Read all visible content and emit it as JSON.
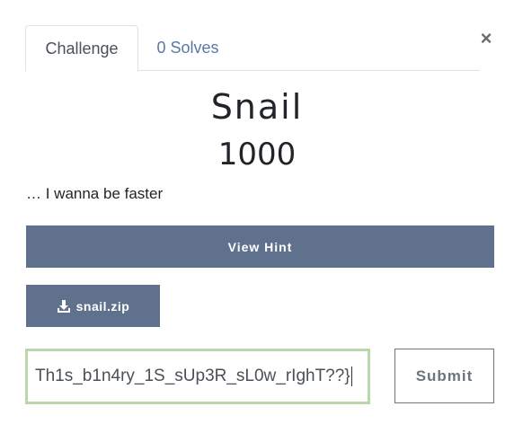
{
  "tabs": [
    {
      "label": "Challenge"
    },
    {
      "label": "0 Solves"
    }
  ],
  "close_label": "×",
  "challenge": {
    "name": "Snail",
    "value": "1000",
    "description": "… I wanna be faster"
  },
  "hint_button": "View Hint",
  "file": {
    "name": "snail.zip",
    "icon": "download-icon"
  },
  "flag_input": {
    "value": "Th1s_b1n4ry_1S_sUp3R_sL0w_rIghT??}"
  },
  "submit_label": "Submit",
  "colors": {
    "button_bg": "#5f718d",
    "link": "#5b77a8",
    "input_focus_border": "#b9d7a8"
  }
}
